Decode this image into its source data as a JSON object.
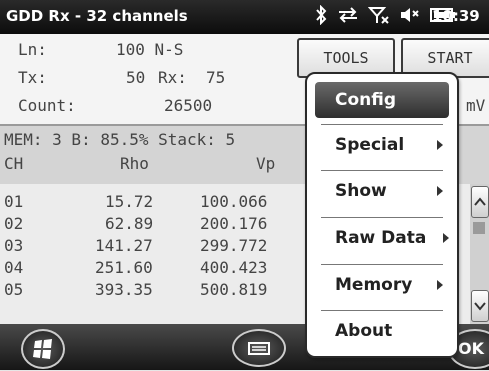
{
  "status": {
    "title": "GDD Rx - 32 channels",
    "time": "10:39",
    "icons": [
      "bluetooth-icon",
      "sync-icon",
      "signal-off-icon",
      "volume-icon",
      "battery-icon"
    ]
  },
  "info": {
    "ln_label": "Ln:",
    "ln_value": "100 N-S",
    "tx_label": "Tx:",
    "tx_value": "50",
    "rx_label": "Rx:",
    "rx_value": "75",
    "count_label": "Count:",
    "count_value": "26500",
    "unit_partial": "mV"
  },
  "buttons": {
    "tools": "TOOLS",
    "start": "START"
  },
  "memline": {
    "text": "MEM: 3 B: 85.5% Stack: 5",
    "col_ch": "CH",
    "col_rho": "Rho",
    "col_vp": "Vp"
  },
  "rows": [
    {
      "ch": "01",
      "rho": "15.72",
      "vp": "100.066"
    },
    {
      "ch": "02",
      "rho": "62.89",
      "vp": "200.176"
    },
    {
      "ch": "03",
      "rho": "141.27",
      "vp": "299.772"
    },
    {
      "ch": "04",
      "rho": "251.60",
      "vp": "400.423"
    },
    {
      "ch": "05",
      "rho": "393.35",
      "vp": "500.819"
    }
  ],
  "menu": {
    "items": [
      {
        "label": "Config",
        "submenu": false,
        "selected": true
      },
      {
        "label": "Special",
        "submenu": true
      },
      {
        "label": "Show",
        "submenu": true
      },
      {
        "label": "Raw Data",
        "submenu": true
      },
      {
        "label": "Memory",
        "submenu": true
      },
      {
        "label": "About",
        "submenu": false
      }
    ]
  },
  "taskbar": {
    "ok_partial": "OK"
  }
}
